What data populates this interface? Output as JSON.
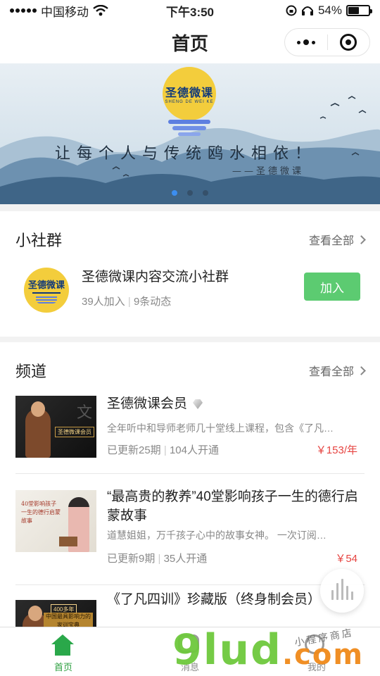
{
  "status_bar": {
    "carrier": "中国移动",
    "time": "下午3:50",
    "battery_percent": "54%",
    "battery_level": 0.54,
    "icons": [
      "signal-icon",
      "wifi-icon",
      "rotation-lock-icon",
      "headphones-icon",
      "battery-icon"
    ]
  },
  "nav": {
    "title": "首页",
    "more_icon": "more-dots-icon",
    "close_icon": "target-icon"
  },
  "banner": {
    "logo_text": "圣德微课",
    "logo_sub": "SHENG DE WEI KE",
    "slogan": "让每个人与传统鸥水相依！",
    "signature": "——圣德微课",
    "slide_count": 3,
    "active_slide": 1,
    "colors": {
      "sky": "#e8eff4",
      "mountain": "#4f7597",
      "logo": "#f3cd3c"
    }
  },
  "community": {
    "title": "小社群",
    "see_all": "查看全部",
    "group": {
      "logo_text": "圣德微课",
      "name": "圣德微课内容交流小社群",
      "members": "39人加入",
      "posts": "9条动态",
      "join_label": "加入"
    }
  },
  "channels": {
    "title": "频道",
    "see_all": "查看全部",
    "items": [
      {
        "title": "圣德微课会员",
        "description": "全年听中和导师老师几十堂线上课程，包含《了凡…",
        "updates": "已更新25期",
        "subscribers": "104人开通",
        "price": "￥153/年",
        "thumb_tag": "圣德微课会员",
        "thumb_char": "文"
      },
      {
        "title": "“最高贵的教养”40堂影响孩子一生的德行启蒙故事",
        "description": "道慧姐姐，万千孩子心中的故事女神。 一次订阅…",
        "updates": "已更新9期",
        "subscribers": "35人开通",
        "price": "￥54",
        "thumb_text": "40堂影响孩子一生的德行启蒙故事"
      },
      {
        "title": "《了凡四训》珍藏版（终身制会员）",
        "thumb_badge": "400多年",
        "thumb_banner": "中国最具影响力的家训宝典"
      }
    ]
  },
  "tab_bar": {
    "tabs": [
      {
        "label": "首页",
        "icon": "home-icon",
        "active": true
      },
      {
        "label": "消息",
        "icon": "chat-icon",
        "active": false
      },
      {
        "label": "我的",
        "icon": "profile-icon",
        "active": false
      }
    ]
  },
  "watermark": {
    "main": "9lud",
    "suffix": ".com",
    "small": "小程序商店"
  }
}
